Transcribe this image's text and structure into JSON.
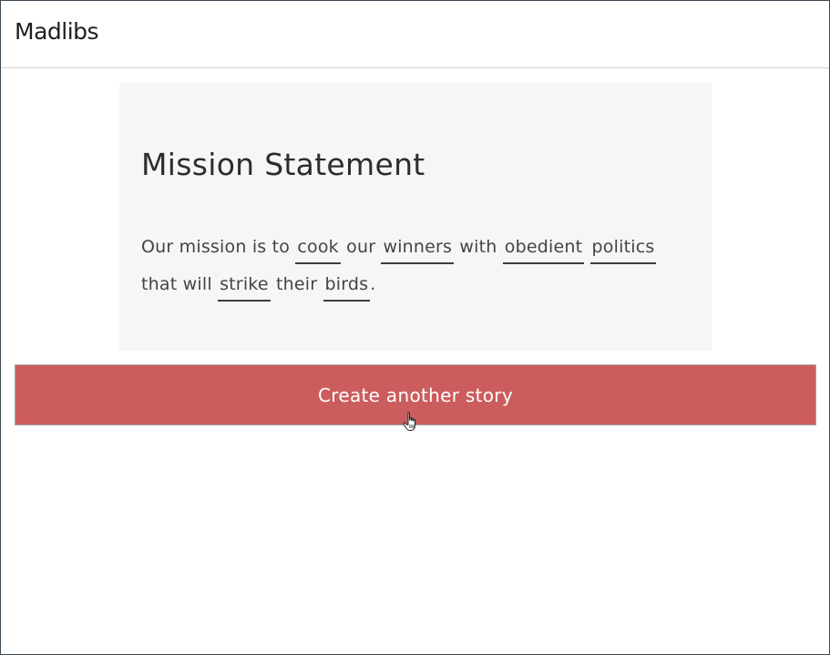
{
  "header": {
    "title": "Madlibs"
  },
  "story": {
    "heading": "Mission Statement",
    "line1": {
      "t1": "Our mission is to",
      "w1": "cook",
      "t2": "our",
      "w2": "winners",
      "t3": "with",
      "w3": "obedient",
      "w4": "politics"
    },
    "line2": {
      "t1": "that will",
      "w1": "strike",
      "t2": "their",
      "w2": "birds",
      "end": "."
    }
  },
  "actions": {
    "create_label": "Create another story"
  },
  "colors": {
    "button_bg": "#cb5d5e",
    "card_bg": "#f6f6f6"
  },
  "icons": {
    "cursor": "hand-pointer-icon"
  }
}
